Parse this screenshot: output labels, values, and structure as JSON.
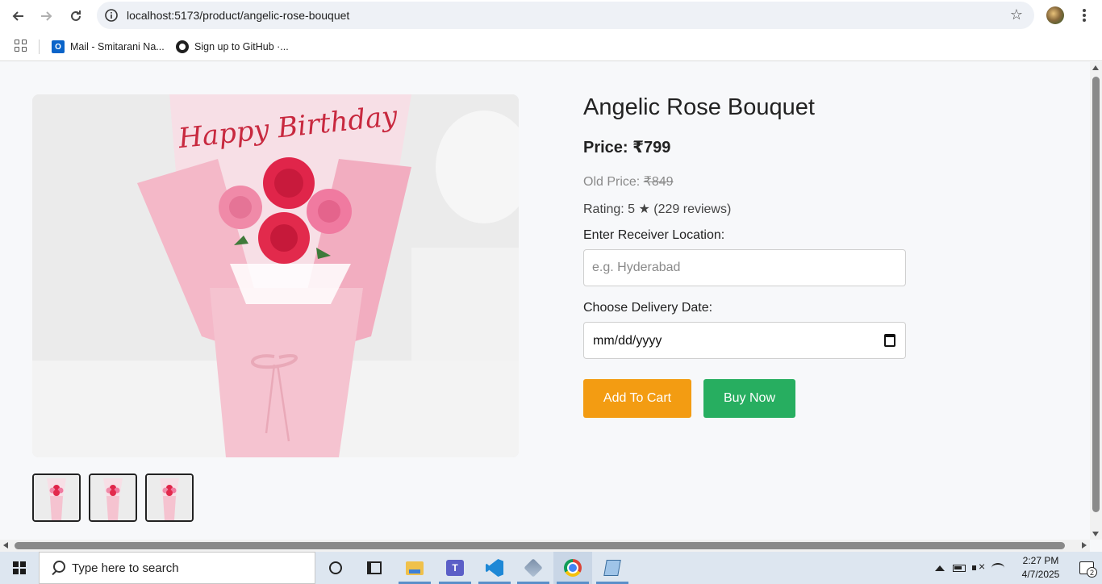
{
  "browser": {
    "url": "localhost:5173/product/angelic-rose-bouquet",
    "bookmarks": [
      {
        "label": "Mail - Smitarani Na...",
        "icon": "outlook-icon"
      },
      {
        "label": "Sign up to GitHub ·...",
        "icon": "github-icon"
      }
    ]
  },
  "product": {
    "title": "Angelic Rose Bouquet",
    "price_label": "Price: ₹799",
    "old_price_prefix": "Old Price: ",
    "old_price_value": "₹849",
    "rating": "Rating: 5 ★ (229 reviews)",
    "image_caption": "Happy Birthday",
    "thumbnail_count": 3
  },
  "form": {
    "location_label": "Enter Receiver Location:",
    "location_placeholder": "e.g. Hyderabad",
    "date_label": "Choose Delivery Date:",
    "date_placeholder": "mm/dd/yyyy"
  },
  "actions": {
    "add_to_cart": "Add To Cart",
    "buy_now": "Buy Now"
  },
  "colors": {
    "add_to_cart": "#f39c12",
    "buy_now": "#27ae60",
    "page_background": "#f7f8fa"
  },
  "taskbar": {
    "search_placeholder": "Type here to search",
    "time": "2:27 PM",
    "date": "4/7/2025",
    "notification_count": "2"
  }
}
